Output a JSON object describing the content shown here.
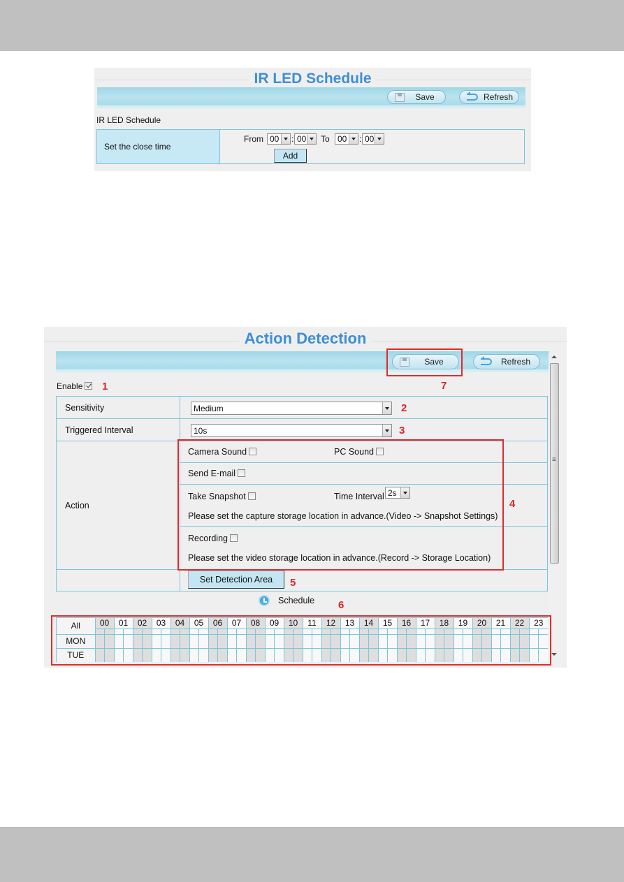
{
  "ir_panel": {
    "title": "IR LED Schedule",
    "toolbar": {
      "save_label": "Save",
      "refresh_label": "Refresh"
    },
    "subtitle": "IR LED Schedule",
    "row_label": "Set the close time",
    "from_label": "From",
    "to_label": "To",
    "from_hour": "00",
    "from_minute": "00",
    "to_hour": "00",
    "to_minute": "00",
    "colon": ":",
    "add_label": "Add"
  },
  "action_panel": {
    "title": "Action Detection",
    "toolbar": {
      "save_label": "Save",
      "refresh_label": "Refresh"
    },
    "enable_label": "Enable",
    "enable_checked": true,
    "sensitivity": {
      "label": "Sensitivity",
      "value": "Medium"
    },
    "triggered_interval": {
      "label": "Triggered Interval",
      "value": "10s"
    },
    "action": {
      "label": "Action",
      "camera_sound": "Camera Sound",
      "pc_sound": "PC Sound",
      "send_email": "Send E-mail",
      "take_snapshot": "Take Snapshot",
      "time_interval_label": "Time Interval",
      "time_interval_value": "2s",
      "snapshot_note": "Please set the capture storage location in advance.(Video -> Snapshot Settings)",
      "recording": "Recording",
      "recording_note": "Please set the video storage location in advance.(Record -> Storage Location)"
    },
    "set_detection_area_label": "Set Detection Area",
    "schedule_label": "Schedule",
    "schedule": {
      "hours": [
        "00",
        "01",
        "02",
        "03",
        "04",
        "05",
        "06",
        "07",
        "08",
        "09",
        "10",
        "11",
        "12",
        "13",
        "14",
        "15",
        "16",
        "17",
        "18",
        "19",
        "20",
        "21",
        "22",
        "23"
      ],
      "days": [
        "All",
        "MON",
        "TUE"
      ]
    }
  },
  "annotations": {
    "n1": "1",
    "n2": "2",
    "n3": "3",
    "n4": "4",
    "n5": "5",
    "n6": "6",
    "n7": "7"
  },
  "colors": {
    "title_blue": "#3d8fd6",
    "annotation_red": "#d9262b",
    "toolbar_blue": "#a9dbe9",
    "border_cyan": "#7cc5dd"
  }
}
